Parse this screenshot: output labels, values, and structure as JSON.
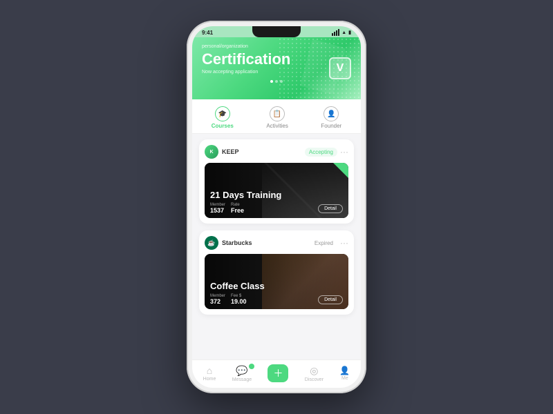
{
  "phone": {
    "statusBar": {
      "time": "9:41",
      "signal": "4G",
      "battery": "100"
    },
    "hero": {
      "label": "personal/organization",
      "title": "Certification",
      "subtitle": "Now accepting application",
      "badge": "V",
      "dots": [
        true,
        false,
        false
      ]
    },
    "tabs": [
      {
        "id": "courses",
        "label": "Courses",
        "icon": "🎓",
        "active": true
      },
      {
        "id": "activities",
        "label": "Activities",
        "icon": "📋",
        "active": false
      },
      {
        "id": "founder",
        "label": "Founder",
        "icon": "👤",
        "active": false
      }
    ],
    "courses": [
      {
        "orgName": "KEEP",
        "orgInitial": "K",
        "status": "Accepting",
        "statusType": "accepting",
        "courseTitle": "21 Days Training",
        "memberLabel": "Member",
        "memberValue": "1537",
        "feeLabel": "Rate",
        "feeValue": "Free",
        "detailBtn": "Detail",
        "type": "gym"
      },
      {
        "orgName": "Starbucks",
        "orgInitial": "☕",
        "status": "Expired",
        "statusType": "expired",
        "courseTitle": "Coffee Class",
        "memberLabel": "Member",
        "memberValue": "372",
        "feeLabel": "Fee $",
        "feeValue": "19.00",
        "detailBtn": "Detail",
        "type": "coffee"
      }
    ],
    "bottomNav": [
      {
        "id": "home",
        "label": "Home",
        "icon": "⌂",
        "active": false
      },
      {
        "id": "message",
        "label": "Message",
        "icon": "💬",
        "active": false,
        "badge": true
      },
      {
        "id": "add",
        "label": "",
        "icon": "＋",
        "active": true
      },
      {
        "id": "discover",
        "label": "Discover",
        "icon": "◎",
        "active": false
      },
      {
        "id": "me",
        "label": "Me",
        "icon": "○",
        "active": false
      }
    ]
  }
}
